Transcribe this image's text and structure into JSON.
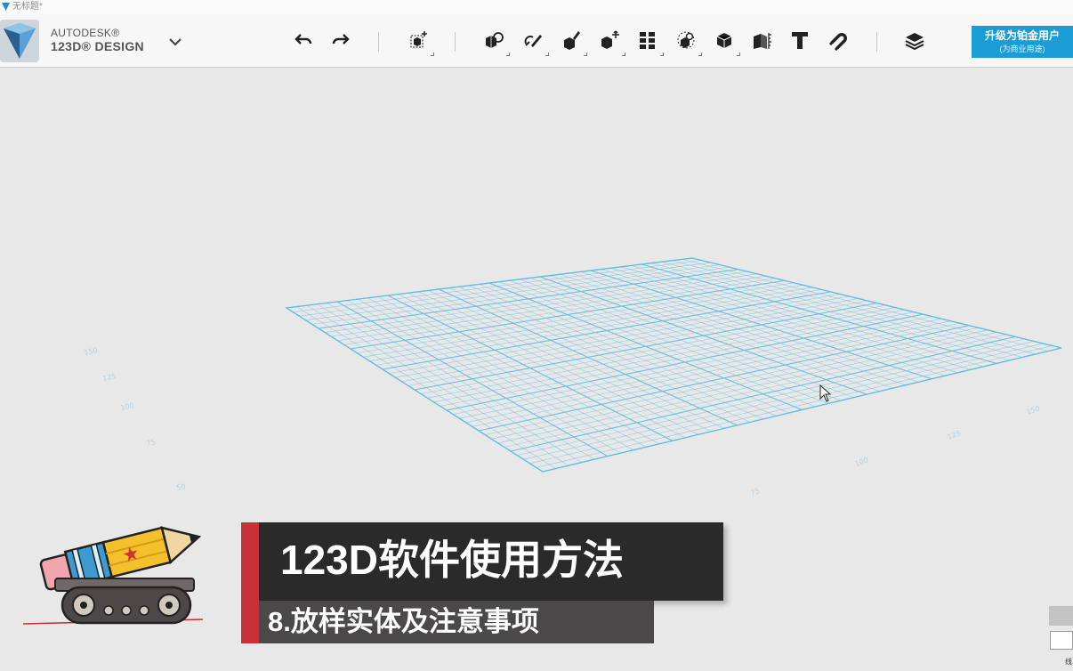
{
  "window": {
    "title": "无标题*"
  },
  "brand": {
    "line1": "AUTODESK®",
    "line2": "123D® DESIGN"
  },
  "toolbar": {
    "undo": "undo-icon",
    "redo": "redo-icon",
    "tools": [
      "transform",
      "primitives",
      "sketch",
      "construct",
      "modify",
      "pattern",
      "grouping",
      "combine",
      "measure",
      "material",
      "text",
      "snap",
      "layers"
    ]
  },
  "upgrade": {
    "label": "升级为铂金用户",
    "sublabel": "(为商业用途)"
  },
  "grid": {
    "color": "#62bde2"
  },
  "axis_labels": {
    "left": [
      "150",
      "125",
      "100",
      "75",
      "50"
    ],
    "right": [
      "150",
      "125",
      "100",
      "75"
    ]
  },
  "caption": {
    "title": "123D软件使用方法",
    "subtitle": "8.放样实体及注意事项",
    "accent": "#c8303a"
  },
  "corner_text": "线"
}
